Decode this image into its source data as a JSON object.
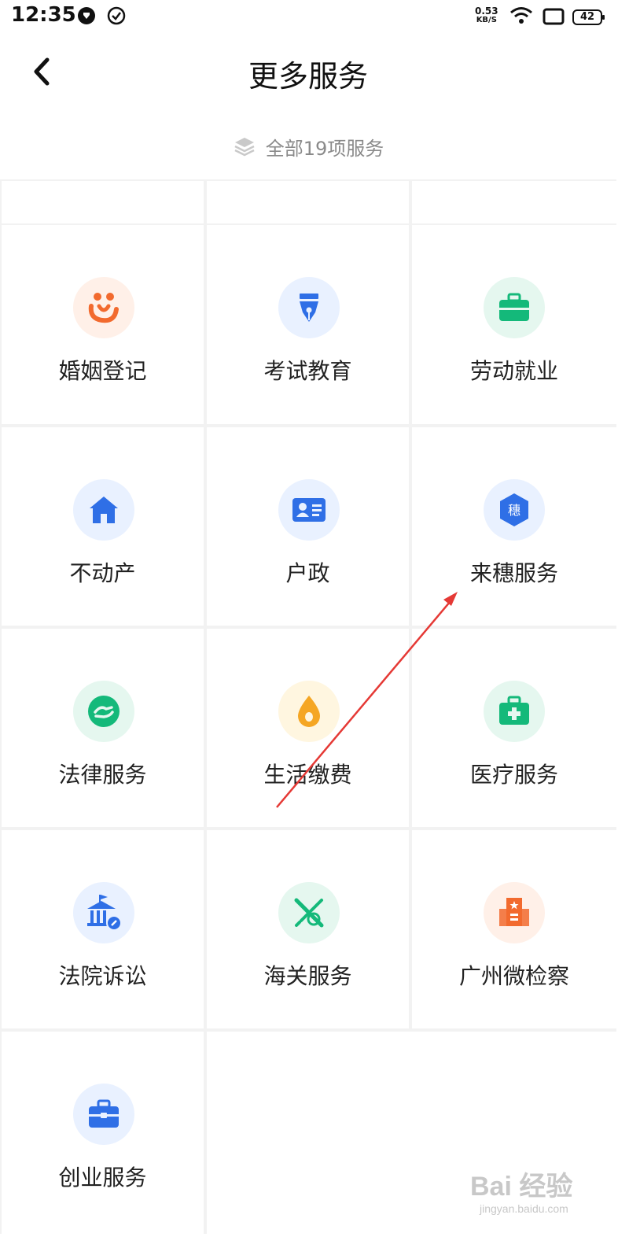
{
  "status_bar": {
    "time": "12:35",
    "speed_value": "0.53",
    "speed_unit": "KB/S",
    "battery": "42",
    "icons": [
      "notification-app-icon",
      "check-circle-icon",
      "wifi-icon",
      "screen-icon",
      "battery-icon"
    ]
  },
  "header": {
    "title": "更多服务",
    "back_icon": "chevron-left-icon"
  },
  "summary": {
    "text": "全部19项服务",
    "icon": "layers-icon"
  },
  "services": [
    {
      "label": "婚姻登记",
      "icon": "marriage-icon",
      "bg": "#fff0e8",
      "color": "#f26a2e"
    },
    {
      "label": "考试教育",
      "icon": "pen-nib-icon",
      "bg": "#e9f1ff",
      "color": "#2f6fe6"
    },
    {
      "label": "劳动就业",
      "icon": "briefcase-icon",
      "bg": "#e5f7ef",
      "color": "#14b97a"
    },
    {
      "label": "不动产",
      "icon": "house-icon",
      "bg": "#e9f1ff",
      "color": "#2f6fe6"
    },
    {
      "label": "户政",
      "icon": "id-card-icon",
      "bg": "#e9f1ff",
      "color": "#2f6fe6"
    },
    {
      "label": "来穗服务",
      "icon": "hexagon-sui-icon",
      "icon_text": "穗",
      "bg": "#e9f1ff",
      "color": "#2f6fe6"
    },
    {
      "label": "法律服务",
      "icon": "handshake-icon",
      "bg": "#e5f7ef",
      "color": "#14b97a"
    },
    {
      "label": "生活缴费",
      "icon": "water-drop-icon",
      "bg": "#fff6e0",
      "color": "#f5a623"
    },
    {
      "label": "医疗服务",
      "icon": "medical-kit-icon",
      "bg": "#e5f7ef",
      "color": "#14b97a"
    },
    {
      "label": "法院诉讼",
      "icon": "courthouse-icon",
      "bg": "#e9f1ff",
      "color": "#2f6fe6"
    },
    {
      "label": "海关服务",
      "icon": "customs-icon",
      "bg": "#e5f7ef",
      "color": "#14b97a"
    },
    {
      "label": "广州微检察",
      "icon": "procuratorate-building-icon",
      "bg": "#fff0e8",
      "color": "#f26a2e"
    },
    {
      "label": "创业服务",
      "icon": "toolbox-icon",
      "bg": "#e9f1ff",
      "color": "#2f6fe6"
    }
  ],
  "annotation": {
    "color": "#e53935"
  },
  "watermark": {
    "main": "Bai 经验",
    "sub": "jingyan.baidu.com"
  }
}
